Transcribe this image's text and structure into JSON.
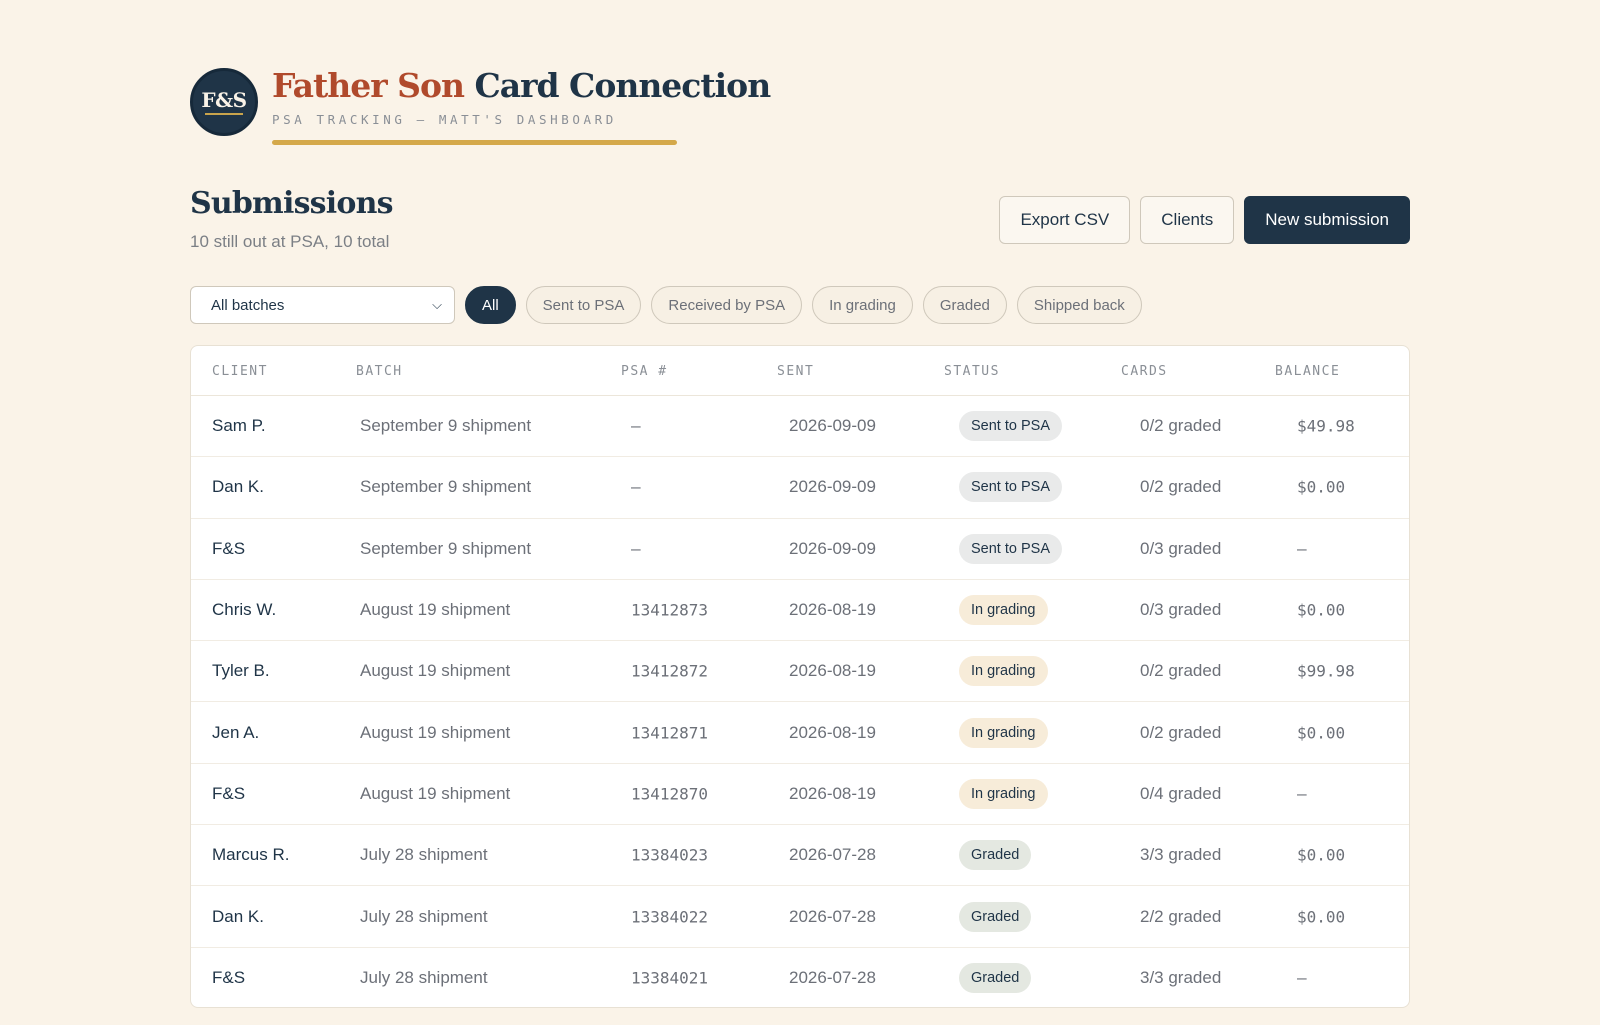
{
  "brand": {
    "logo_text": "F&S",
    "title_part1": "Father Son",
    "title_part2": "Card Connection",
    "subtitle": "PSA TRACKING — MATT'S DASHBOARD"
  },
  "page": {
    "title": "Submissions",
    "subtitle": "10 still out at PSA, 10 total"
  },
  "actions": {
    "export_label": "Export CSV",
    "clients_label": "Clients",
    "new_label": "New submission"
  },
  "filters": {
    "batch_select": "All batches",
    "pills": [
      "All",
      "Sent to PSA",
      "Received by PSA",
      "In grading",
      "Graded",
      "Shipped back"
    ],
    "active": "All"
  },
  "table": {
    "headers": [
      "CLIENT",
      "BATCH",
      "PSA #",
      "SENT",
      "STATUS",
      "CARDS",
      "BALANCE"
    ],
    "rows": [
      {
        "client": "Sam P.",
        "batch": "September 9 shipment",
        "psa": "—",
        "sent": "2026-09-09",
        "status": "Sent to PSA",
        "cards": "0/2 graded",
        "balance": "$49.98"
      },
      {
        "client": "Dan K.",
        "batch": "September 9 shipment",
        "psa": "—",
        "sent": "2026-09-09",
        "status": "Sent to PSA",
        "cards": "0/2 graded",
        "balance": "$0.00"
      },
      {
        "client": "F&S",
        "batch": "September 9 shipment",
        "psa": "—",
        "sent": "2026-09-09",
        "status": "Sent to PSA",
        "cards": "0/3 graded",
        "balance": "—"
      },
      {
        "client": "Chris W.",
        "batch": "August 19 shipment",
        "psa": "13412873",
        "sent": "2026-08-19",
        "status": "In grading",
        "cards": "0/3 graded",
        "balance": "$0.00"
      },
      {
        "client": "Tyler B.",
        "batch": "August 19 shipment",
        "psa": "13412872",
        "sent": "2026-08-19",
        "status": "In grading",
        "cards": "0/2 graded",
        "balance": "$99.98"
      },
      {
        "client": "Jen A.",
        "batch": "August 19 shipment",
        "psa": "13412871",
        "sent": "2026-08-19",
        "status": "In grading",
        "cards": "0/2 graded",
        "balance": "$0.00"
      },
      {
        "client": "F&S",
        "batch": "August 19 shipment",
        "psa": "13412870",
        "sent": "2026-08-19",
        "status": "In grading",
        "cards": "0/4 graded",
        "balance": "—"
      },
      {
        "client": "Marcus R.",
        "batch": "July 28 shipment",
        "psa": "13384023",
        "sent": "2026-07-28",
        "status": "Graded",
        "cards": "3/3 graded",
        "balance": "$0.00"
      },
      {
        "client": "Dan K.",
        "batch": "July 28 shipment",
        "psa": "13384022",
        "sent": "2026-07-28",
        "status": "Graded",
        "cards": "2/2 graded",
        "balance": "$0.00"
      },
      {
        "client": "F&S",
        "batch": "July 28 shipment",
        "psa": "13384021",
        "sent": "2026-07-28",
        "status": "Graded",
        "cards": "3/3 graded",
        "balance": "—"
      }
    ]
  },
  "colors": {
    "background": "#faf3e8",
    "navy": "#1f3447",
    "brand_red": "#b04a2c",
    "gold": "#d4a84a",
    "badge_sent": "#e9eaea",
    "badge_grading": "#f7ecd9",
    "badge_graded": "#e4e8e1"
  }
}
